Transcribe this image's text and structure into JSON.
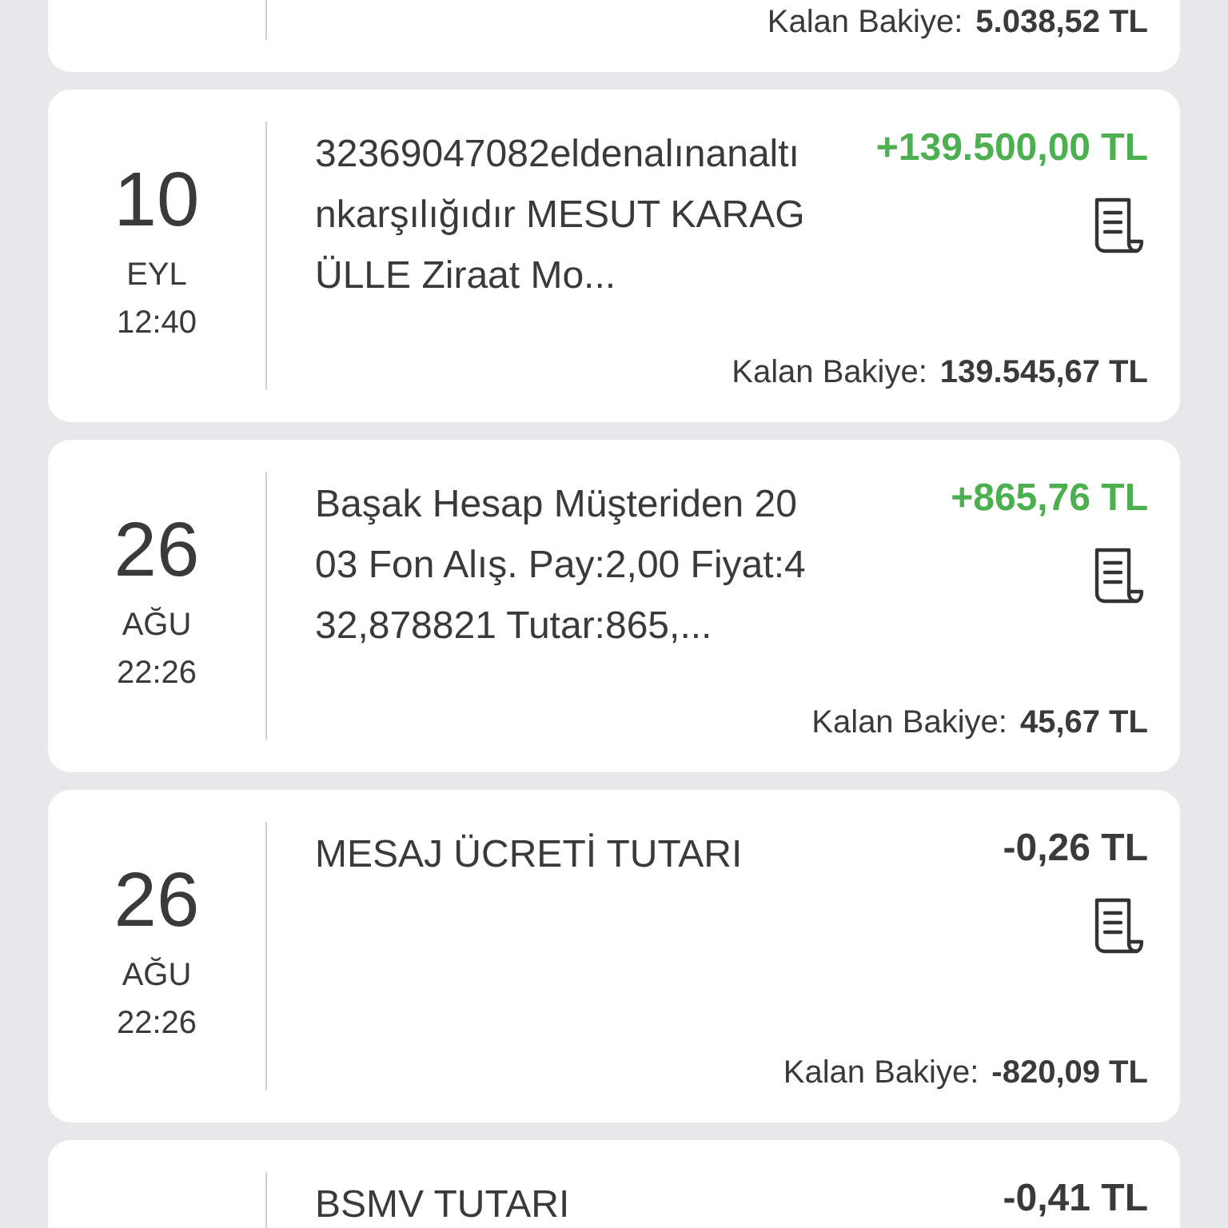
{
  "transactions": [
    {
      "balance_label": "Kalan Bakiye:",
      "balance": "5.038,52 TL"
    },
    {
      "day": "10",
      "month": "EYL",
      "time": "12:40",
      "description": "32369047082eldenalınanaltınkarşılığıdır MESUT KARAGÜLLE Ziraat Mo...",
      "amount": "+139.500,00 TL",
      "kind": "credit",
      "balance_label": "Kalan Bakiye:",
      "balance": "139.545,67 TL"
    },
    {
      "day": "26",
      "month": "AĞU",
      "time": "22:26",
      "description": "Başak Hesap Müşteriden 2003 Fon Alış. Pay:2,00 Fiyat:432,878821 Tutar:865,...",
      "amount": "+865,76 TL",
      "kind": "credit",
      "balance_label": "Kalan Bakiye:",
      "balance": "45,67 TL"
    },
    {
      "day": "26",
      "month": "AĞU",
      "time": "22:26",
      "description": "MESAJ ÜCRETİ TUTARI",
      "amount": "-0,26 TL",
      "kind": "debit",
      "balance_label": "Kalan Bakiye:",
      "balance": "-820,09 TL"
    },
    {
      "description": "BSMV TUTARI",
      "amount": "-0,41 TL",
      "kind": "debit"
    }
  ]
}
